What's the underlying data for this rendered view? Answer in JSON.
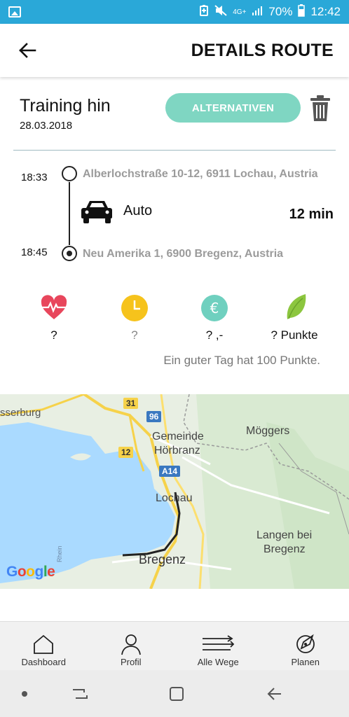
{
  "status_bar": {
    "network": "4G+",
    "battery": "70%",
    "time": "12:42"
  },
  "header": {
    "title": "DETAILS ROUTE",
    "back_icon": "arrow-left-icon"
  },
  "route": {
    "name": "Training hin",
    "date": "28.03.2018",
    "alternatives_label": "ALTERNATIVEN",
    "delete_icon": "trash-icon"
  },
  "timeline": {
    "start_time": "18:33",
    "start_address": "Alberlochstraße 10-12, 6911 Lochau, Austria",
    "mode": "Auto",
    "mode_icon": "car-icon",
    "duration": "12 min",
    "end_time": "18:45",
    "end_address": "Neu Amerika 1, 6900 Bregenz, Austria"
  },
  "metrics": [
    {
      "icon": "heart-pulse-icon",
      "value": "?",
      "color": "#e8465c"
    },
    {
      "icon": "clock-icon",
      "value": "?",
      "color": "#f6c31c"
    },
    {
      "icon": "euro-icon",
      "value": "? ,-",
      "color": "#6fd0bf"
    },
    {
      "icon": "leaf-icon",
      "value": "? Punkte",
      "color": "#8cc63f"
    }
  ],
  "hint": "Ein guter Tag hat 100 Punkte.",
  "map": {
    "labels": {
      "wasserburg": "sserburg",
      "gemeinde": "Gemeinde",
      "horbranz": "Hörbranz",
      "moeggers": "Möggers",
      "lochau": "Lochau",
      "langen": "Langen bei",
      "bregenz_small": "Bregenz",
      "bregenz": "Bregenz",
      "rhein": "Rhein"
    },
    "shields": {
      "r31": "31",
      "r96": "96",
      "r12": "12",
      "a14": "A14"
    },
    "logo": "Google"
  },
  "bottom_nav": [
    {
      "label": "Dashboard",
      "icon": "home-icon"
    },
    {
      "label": "Profil",
      "icon": "user-icon"
    },
    {
      "label": "Alle Wege",
      "icon": "routes-icon"
    },
    {
      "label": "Planen",
      "icon": "compass-icon"
    }
  ],
  "colors": {
    "status_bar": "#2aa8d8",
    "accent": "#7fd6c2",
    "water": "#aadaff",
    "route": "#222222"
  }
}
